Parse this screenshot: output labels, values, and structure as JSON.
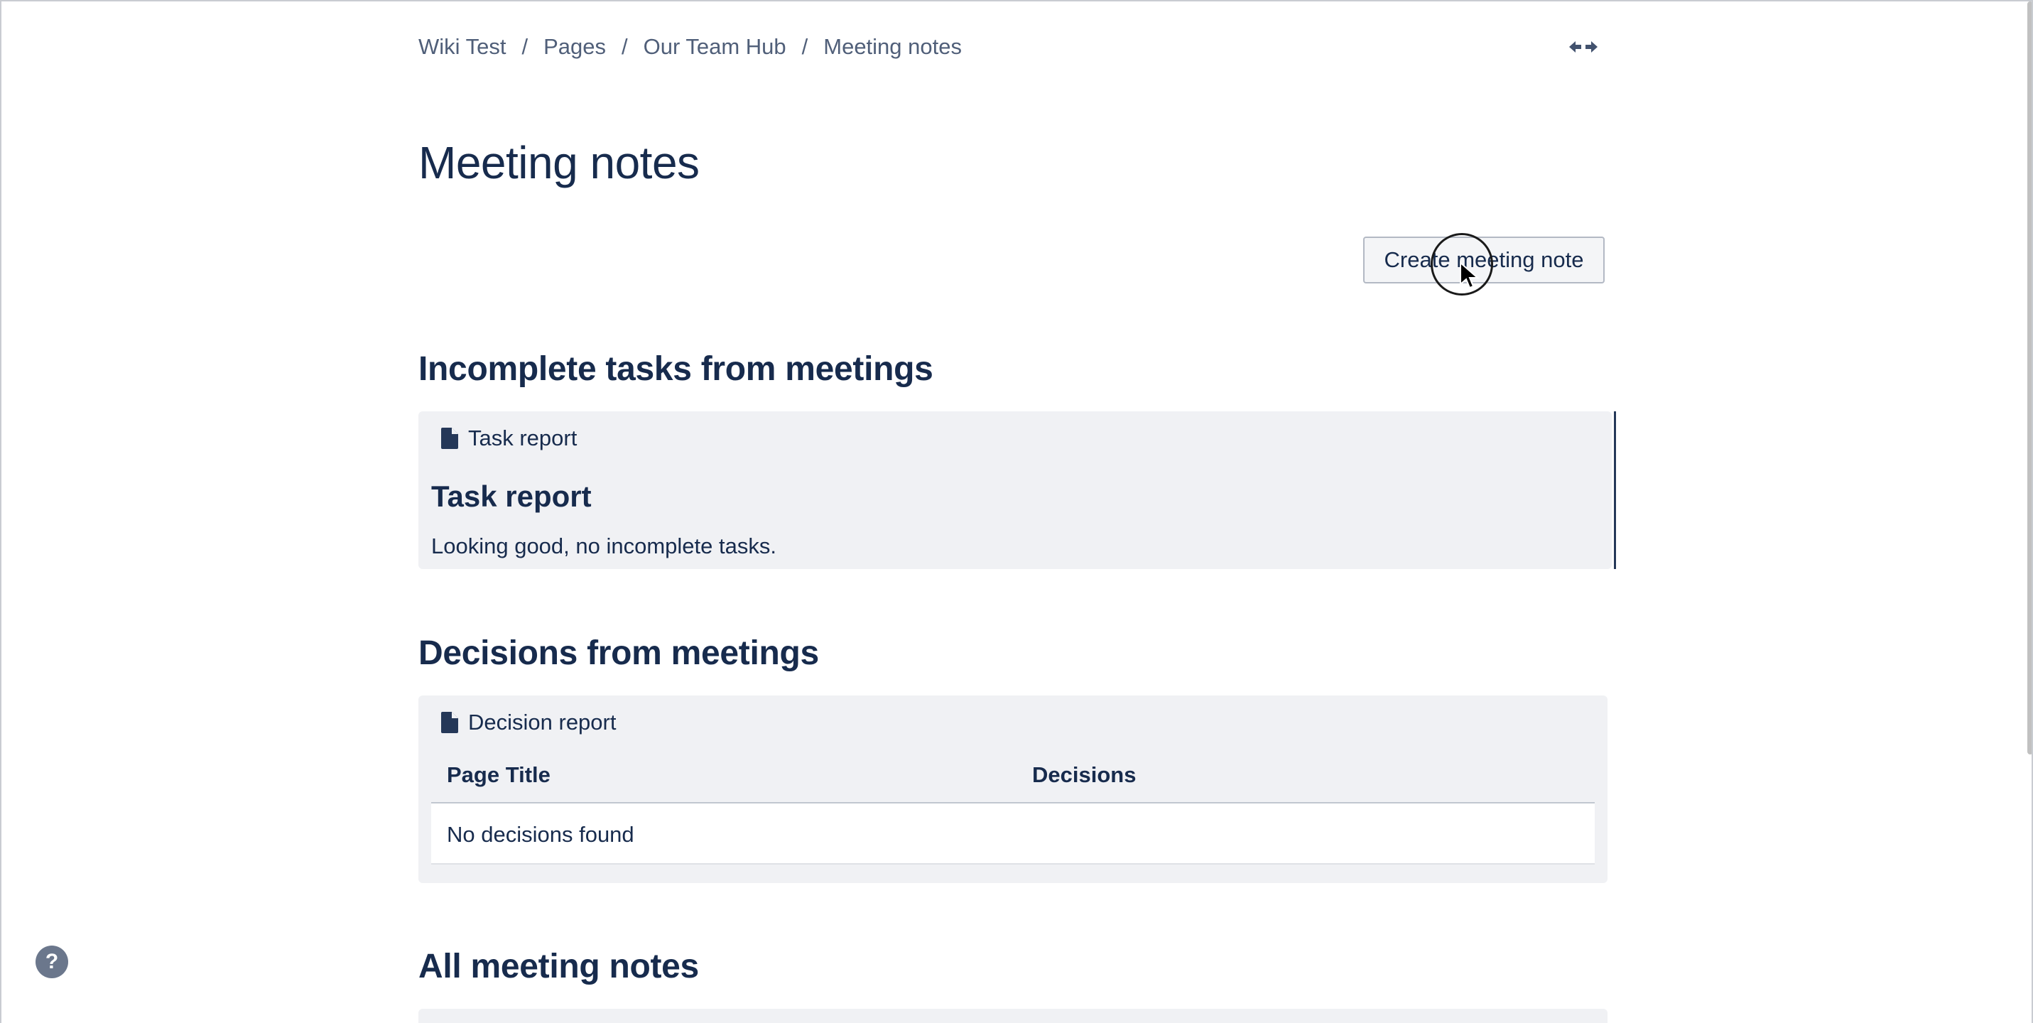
{
  "breadcrumb": {
    "items": [
      "Wiki Test",
      "Pages",
      "Our Team Hub",
      "Meeting notes"
    ],
    "separator": "/"
  },
  "page": {
    "title": "Meeting notes",
    "create_button_label": "Create meeting note"
  },
  "sections": {
    "incomplete_tasks": {
      "heading": "Incomplete tasks from meetings",
      "macro_label": "Task report",
      "title": "Task report",
      "message": "Looking good, no incomplete tasks."
    },
    "decisions": {
      "heading": "Decisions from meetings",
      "macro_label": "Decision report",
      "columns": [
        "Page Title",
        "Decisions"
      ],
      "empty_message": "No decisions found"
    },
    "all_notes": {
      "heading": "All meeting notes"
    }
  },
  "icons": {
    "expand": "expand-width-icon",
    "document": "document-icon",
    "help": "help-icon"
  },
  "help": {
    "glyph": "?"
  }
}
